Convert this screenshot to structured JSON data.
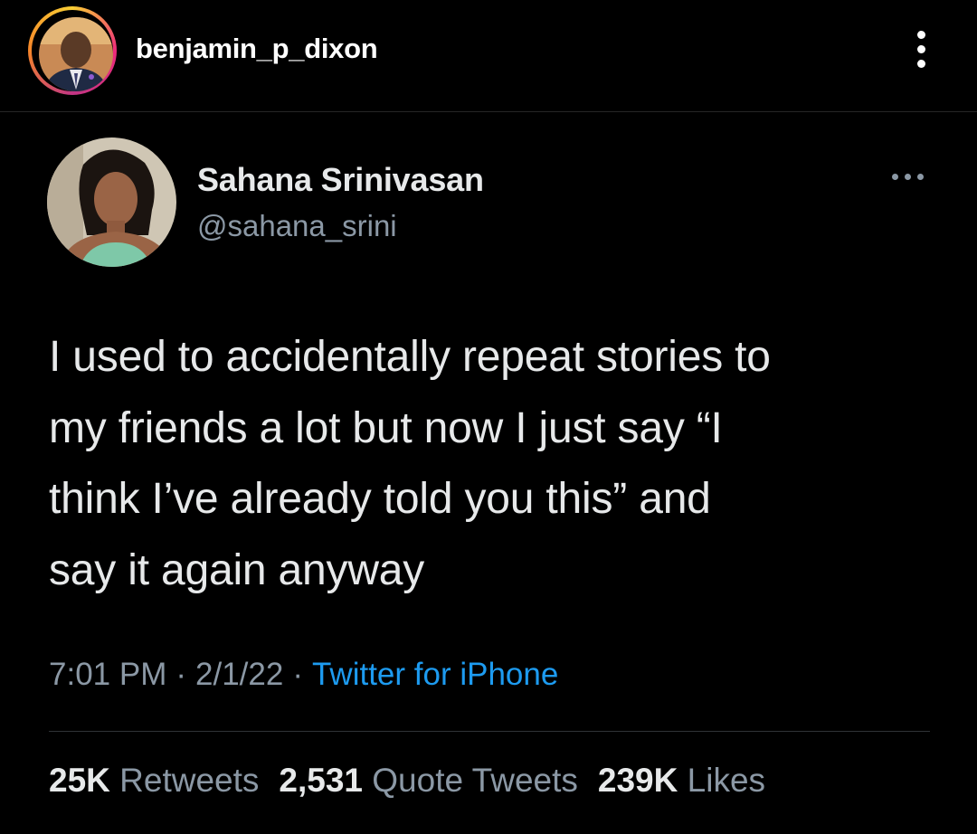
{
  "post_header": {
    "username": "benjamin_p_dixon",
    "more_icon": "vertical-ellipsis-icon"
  },
  "tweet": {
    "display_name": "Sahana Srinivasan",
    "handle": "@sahana_srini",
    "more_icon": "horizontal-ellipsis-icon",
    "text_lines": [
      "I used to accidentally repeat stories to",
      "my friends a lot but now I just say “I",
      "think I’ve already told you this” and",
      "say it again anyway"
    ],
    "time": "7:01 PM",
    "date": "2/1/22",
    "separator": "·",
    "source": "Twitter for iPhone",
    "stats": {
      "retweets_count": "25K",
      "retweets_label": "Retweets",
      "quotes_count": "2,531",
      "quotes_label": "Quote Tweets",
      "likes_count": "239K",
      "likes_label": "Likes"
    }
  },
  "colors": {
    "background": "#000000",
    "text_primary": "#e7e9ea",
    "text_secondary": "#8b98a5",
    "link": "#1d9bf0"
  }
}
